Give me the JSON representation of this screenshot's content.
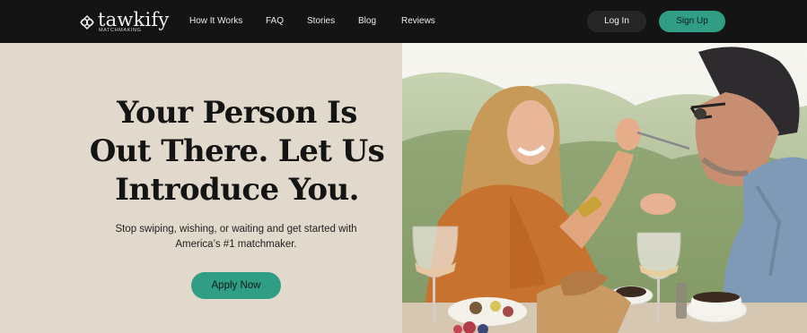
{
  "brand": {
    "name": "tawkify",
    "tagline": "MATCHMAKING"
  },
  "nav": {
    "links": [
      "How It Works",
      "FAQ",
      "Stories",
      "Blog",
      "Reviews"
    ],
    "login_label": "Log In",
    "signup_label": "Sign Up"
  },
  "hero": {
    "headline_lines": [
      "Your Person Is",
      "Out There. Let Us",
      "Introduce You."
    ],
    "subtext_lines": [
      "Stop swiping, wishing, or waiting and get started with",
      "America’s #1 matchmaker."
    ],
    "cta_label": "Apply Now",
    "image_icon": "couple-dining-photo"
  },
  "colors": {
    "nav_bg": "#141414",
    "accent": "#2f9e85",
    "hero_bg": "#e1d9cb",
    "text_dark": "#141414"
  }
}
